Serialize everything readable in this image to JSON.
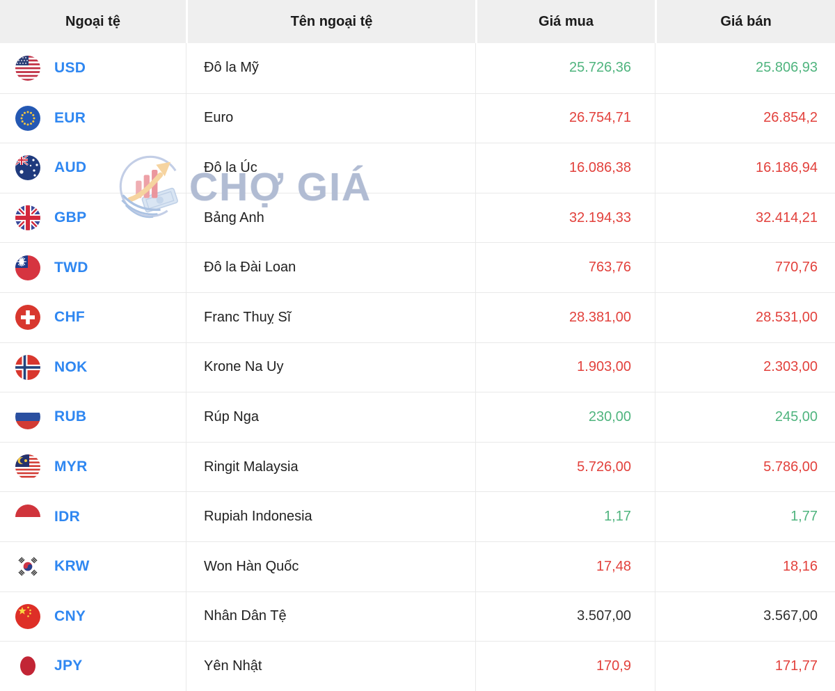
{
  "table": {
    "columns": [
      {
        "label": "Ngoại tệ"
      },
      {
        "label": "Tên ngoại tệ"
      },
      {
        "label": "Giá mua"
      },
      {
        "label": "Giá bán"
      }
    ],
    "rows": [
      {
        "code": "USD",
        "flag": "usd",
        "name": "Đô la Mỹ",
        "buy": "25.726,36",
        "sell": "25.806,93",
        "trend": "green"
      },
      {
        "code": "EUR",
        "flag": "eur",
        "name": "Euro",
        "buy": "26.754,71",
        "sell": "26.854,2",
        "trend": "red"
      },
      {
        "code": "AUD",
        "flag": "aud",
        "name": "Đô la Úc",
        "buy": "16.086,38",
        "sell": "16.186,94",
        "trend": "red"
      },
      {
        "code": "GBP",
        "flag": "gbp",
        "name": "Bảng Anh",
        "buy": "32.194,33",
        "sell": "32.414,21",
        "trend": "red"
      },
      {
        "code": "TWD",
        "flag": "twd",
        "name": "Đô la Đài Loan",
        "buy": "763,76",
        "sell": "770,76",
        "trend": "red"
      },
      {
        "code": "CHF",
        "flag": "chf",
        "name": "Franc Thuỵ Sĩ",
        "buy": "28.381,00",
        "sell": "28.531,00",
        "trend": "red"
      },
      {
        "code": "NOK",
        "flag": "nok",
        "name": "Krone Na Uy",
        "buy": "1.903,00",
        "sell": "2.303,00",
        "trend": "red"
      },
      {
        "code": "RUB",
        "flag": "rub",
        "name": "Rúp Nga",
        "buy": "230,00",
        "sell": "245,00",
        "trend": "green"
      },
      {
        "code": "MYR",
        "flag": "myr",
        "name": "Ringit Malaysia",
        "buy": "5.726,00",
        "sell": "5.786,00",
        "trend": "red"
      },
      {
        "code": "IDR",
        "flag": "idr",
        "name": "Rupiah Indonesia",
        "buy": "1,17",
        "sell": "1,77",
        "trend": "green"
      },
      {
        "code": "KRW",
        "flag": "krw",
        "name": "Won Hàn Quốc",
        "buy": "17,48",
        "sell": "18,16",
        "trend": "red"
      },
      {
        "code": "CNY",
        "flag": "cny",
        "name": "Nhân Dân Tệ",
        "buy": "3.507,00",
        "sell": "3.567,00",
        "trend": "neutral"
      },
      {
        "code": "JPY",
        "flag": "jpy",
        "name": "Yên Nhật",
        "buy": "170,9",
        "sell": "171,77",
        "trend": "red"
      }
    ]
  },
  "watermark": {
    "text": "CHỢ GIÁ"
  },
  "colors": {
    "up_green": "#4fb47e",
    "down_red": "#e2413c",
    "neutral_dark": "#2f2f2f",
    "code_blue": "#2f87f1",
    "header_bg": "#efefef",
    "border": "#e9e9e9",
    "watermark_text": "#a8b4ce"
  }
}
